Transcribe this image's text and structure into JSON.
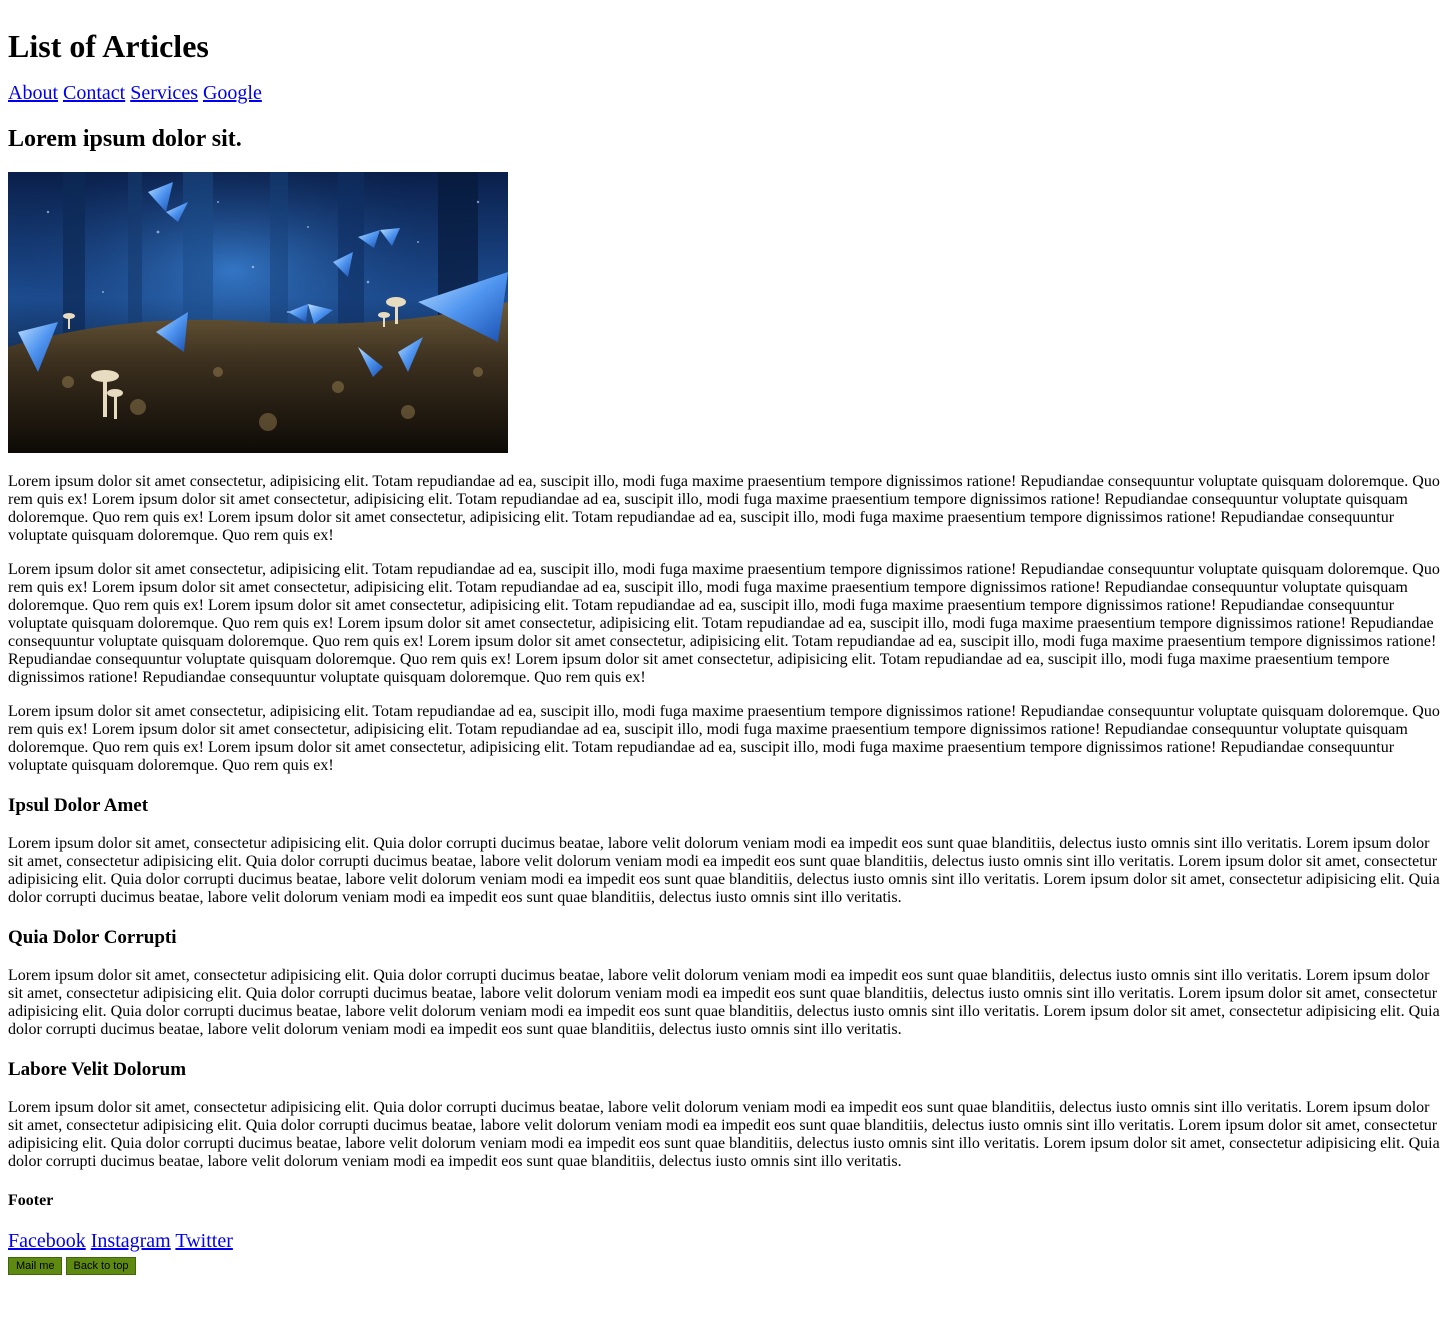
{
  "page": {
    "title": "List of Articles"
  },
  "nav": {
    "links": [
      "About",
      "Contact",
      "Services",
      "Google"
    ]
  },
  "article": {
    "title": "Lorem ipsum dolor sit.",
    "image_alt": "butterflies-and-mushrooms-image",
    "paragraphs": [
      "Lorem ipsum dolor sit amet consectetur, adipisicing elit. Totam repudiandae ad ea, suscipit illo, modi fuga maxime praesentium tempore dignissimos ratione! Repudiandae consequuntur voluptate quisquam doloremque. Quo rem quis ex! Lorem ipsum dolor sit amet consectetur, adipisicing elit. Totam repudiandae ad ea, suscipit illo, modi fuga maxime praesentium tempore dignissimos ratione! Repudiandae consequuntur voluptate quisquam doloremque. Quo rem quis ex! Lorem ipsum dolor sit amet consectetur, adipisicing elit. Totam repudiandae ad ea, suscipit illo, modi fuga maxime praesentium tempore dignissimos ratione! Repudiandae consequuntur voluptate quisquam doloremque. Quo rem quis ex!",
      "Lorem ipsum dolor sit amet consectetur, adipisicing elit. Totam repudiandae ad ea, suscipit illo, modi fuga maxime praesentium tempore dignissimos ratione! Repudiandae consequuntur voluptate quisquam doloremque. Quo rem quis ex! Lorem ipsum dolor sit amet consectetur, adipisicing elit. Totam repudiandae ad ea, suscipit illo, modi fuga maxime praesentium tempore dignissimos ratione! Repudiandae consequuntur voluptate quisquam doloremque. Quo rem quis ex! Lorem ipsum dolor sit amet consectetur, adipisicing elit. Totam repudiandae ad ea, suscipit illo, modi fuga maxime praesentium tempore dignissimos ratione! Repudiandae consequuntur voluptate quisquam doloremque. Quo rem quis ex! Lorem ipsum dolor sit amet consectetur, adipisicing elit. Totam repudiandae ad ea, suscipit illo, modi fuga maxime praesentium tempore dignissimos ratione! Repudiandae consequuntur voluptate quisquam doloremque. Quo rem quis ex! Lorem ipsum dolor sit amet consectetur, adipisicing elit. Totam repudiandae ad ea, suscipit illo, modi fuga maxime praesentium tempore dignissimos ratione! Repudiandae consequuntur voluptate quisquam doloremque. Quo rem quis ex! Lorem ipsum dolor sit amet consectetur, adipisicing elit. Totam repudiandae ad ea, suscipit illo, modi fuga maxime praesentium tempore dignissimos ratione! Repudiandae consequuntur voluptate quisquam doloremque. Quo rem quis ex!",
      "Lorem ipsum dolor sit amet consectetur, adipisicing elit. Totam repudiandae ad ea, suscipit illo, modi fuga maxime praesentium tempore dignissimos ratione! Repudiandae consequuntur voluptate quisquam doloremque. Quo rem quis ex! Lorem ipsum dolor sit amet consectetur, adipisicing elit. Totam repudiandae ad ea, suscipit illo, modi fuga maxime praesentium tempore dignissimos ratione! Repudiandae consequuntur voluptate quisquam doloremque. Quo rem quis ex! Lorem ipsum dolor sit amet consectetur, adipisicing elit. Totam repudiandae ad ea, suscipit illo, modi fuga maxime praesentium tempore dignissimos ratione! Repudiandae consequuntur voluptate quisquam doloremque. Quo rem quis ex!"
    ]
  },
  "sections": [
    {
      "heading": "Ipsul Dolor Amet",
      "text": "Lorem ipsum dolor sit amet, consectetur adipisicing elit. Quia dolor corrupti ducimus beatae, labore velit dolorum veniam modi ea impedit eos sunt quae blanditiis, delectus iusto omnis sint illo veritatis. Lorem ipsum dolor sit amet, consectetur adipisicing elit. Quia dolor corrupti ducimus beatae, labore velit dolorum veniam modi ea impedit eos sunt quae blanditiis, delectus iusto omnis sint illo veritatis. Lorem ipsum dolor sit amet, consectetur adipisicing elit. Quia dolor corrupti ducimus beatae, labore velit dolorum veniam modi ea impedit eos sunt quae blanditiis, delectus iusto omnis sint illo veritatis. Lorem ipsum dolor sit amet, consectetur adipisicing elit. Quia dolor corrupti ducimus beatae, labore velit dolorum veniam modi ea impedit eos sunt quae blanditiis, delectus iusto omnis sint illo veritatis."
    },
    {
      "heading": "Quia Dolor Corrupti",
      "text": "Lorem ipsum dolor sit amet, consectetur adipisicing elit. Quia dolor corrupti ducimus beatae, labore velit dolorum veniam modi ea impedit eos sunt quae blanditiis, delectus iusto omnis sint illo veritatis. Lorem ipsum dolor sit amet, consectetur adipisicing elit. Quia dolor corrupti ducimus beatae, labore velit dolorum veniam modi ea impedit eos sunt quae blanditiis, delectus iusto omnis sint illo veritatis. Lorem ipsum dolor sit amet, consectetur adipisicing elit. Quia dolor corrupti ducimus beatae, labore velit dolorum veniam modi ea impedit eos sunt quae blanditiis, delectus iusto omnis sint illo veritatis. Lorem ipsum dolor sit amet, consectetur adipisicing elit. Quia dolor corrupti ducimus beatae, labore velit dolorum veniam modi ea impedit eos sunt quae blanditiis, delectus iusto omnis sint illo veritatis."
    },
    {
      "heading": "Labore Velit Dolorum",
      "text": "Lorem ipsum dolor sit amet, consectetur adipisicing elit. Quia dolor corrupti ducimus beatae, labore velit dolorum veniam modi ea impedit eos sunt quae blanditiis, delectus iusto omnis sint illo veritatis. Lorem ipsum dolor sit amet, consectetur adipisicing elit. Quia dolor corrupti ducimus beatae, labore velit dolorum veniam modi ea impedit eos sunt quae blanditiis, delectus iusto omnis sint illo veritatis. Lorem ipsum dolor sit amet, consectetur adipisicing elit. Quia dolor corrupti ducimus beatae, labore velit dolorum veniam modi ea impedit eos sunt quae blanditiis, delectus iusto omnis sint illo veritatis. Lorem ipsum dolor sit amet, consectetur adipisicing elit. Quia dolor corrupti ducimus beatae, labore velit dolorum veniam modi ea impedit eos sunt quae blanditiis, delectus iusto omnis sint illo veritatis."
    }
  ],
  "footer": {
    "heading": "Footer",
    "links": [
      "Facebook",
      "Instagram",
      "Twitter"
    ],
    "buttons": {
      "mail": "Mail me",
      "top": "Back to top"
    },
    "button_color": "#5f8a12"
  },
  "colors": {
    "link": "#0000ee",
    "text": "#000000",
    "background": "#ffffff"
  }
}
